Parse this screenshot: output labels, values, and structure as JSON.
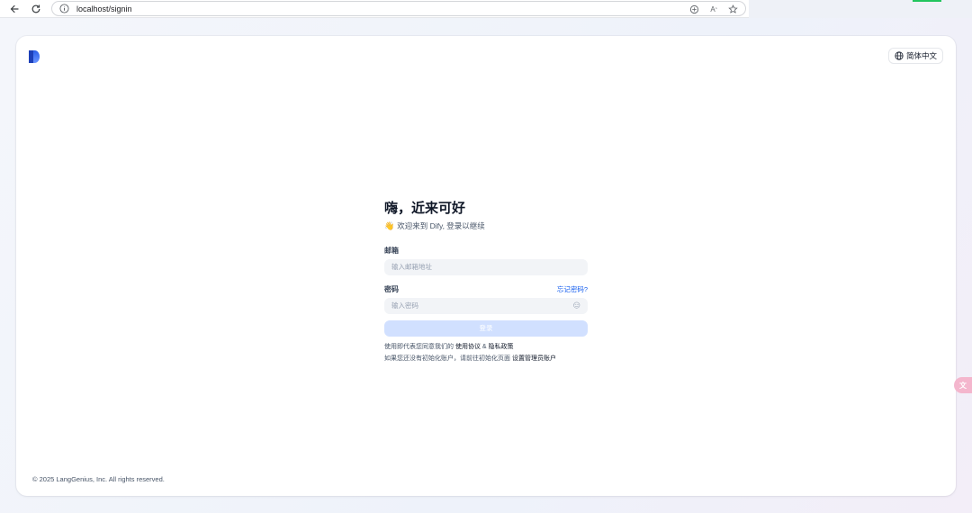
{
  "browser": {
    "url": "localhost/signin"
  },
  "header": {
    "language_label": "简体中文"
  },
  "login": {
    "title": "嗨，近来可好",
    "subtitle": "欢迎来到 Dify, 登录以继续",
    "subtitle_emoji": "👋",
    "email_label": "邮箱",
    "email_placeholder": "输入邮箱地址",
    "password_label": "密码",
    "forgot_password": "忘记密码?",
    "password_placeholder": "输入密码",
    "submit_label": "登录",
    "terms_prefix": "使用即代表您同意我们的",
    "terms_link": "使用协议",
    "terms_and": "&",
    "privacy_link": "隐私政策",
    "init_prefix": "如果您还没有初始化账户，请前往初始化页面",
    "init_link": "设置管理员账户"
  },
  "footer": {
    "copyright": "© 2025 LangGenius, Inc. All rights reserved."
  },
  "side_tab": {
    "label": "文"
  },
  "colors": {
    "accent": "#155eef",
    "submit_disabled": "#d1e0ff",
    "input_bg": "#f2f4f7",
    "title": "#101828"
  },
  "icons": [
    "back-arrow-icon",
    "reload-icon",
    "info-icon",
    "translate-icon",
    "read-aloud-icon",
    "star-icon",
    "globe-icon",
    "eye-icon",
    "dify-logo-icon"
  ]
}
